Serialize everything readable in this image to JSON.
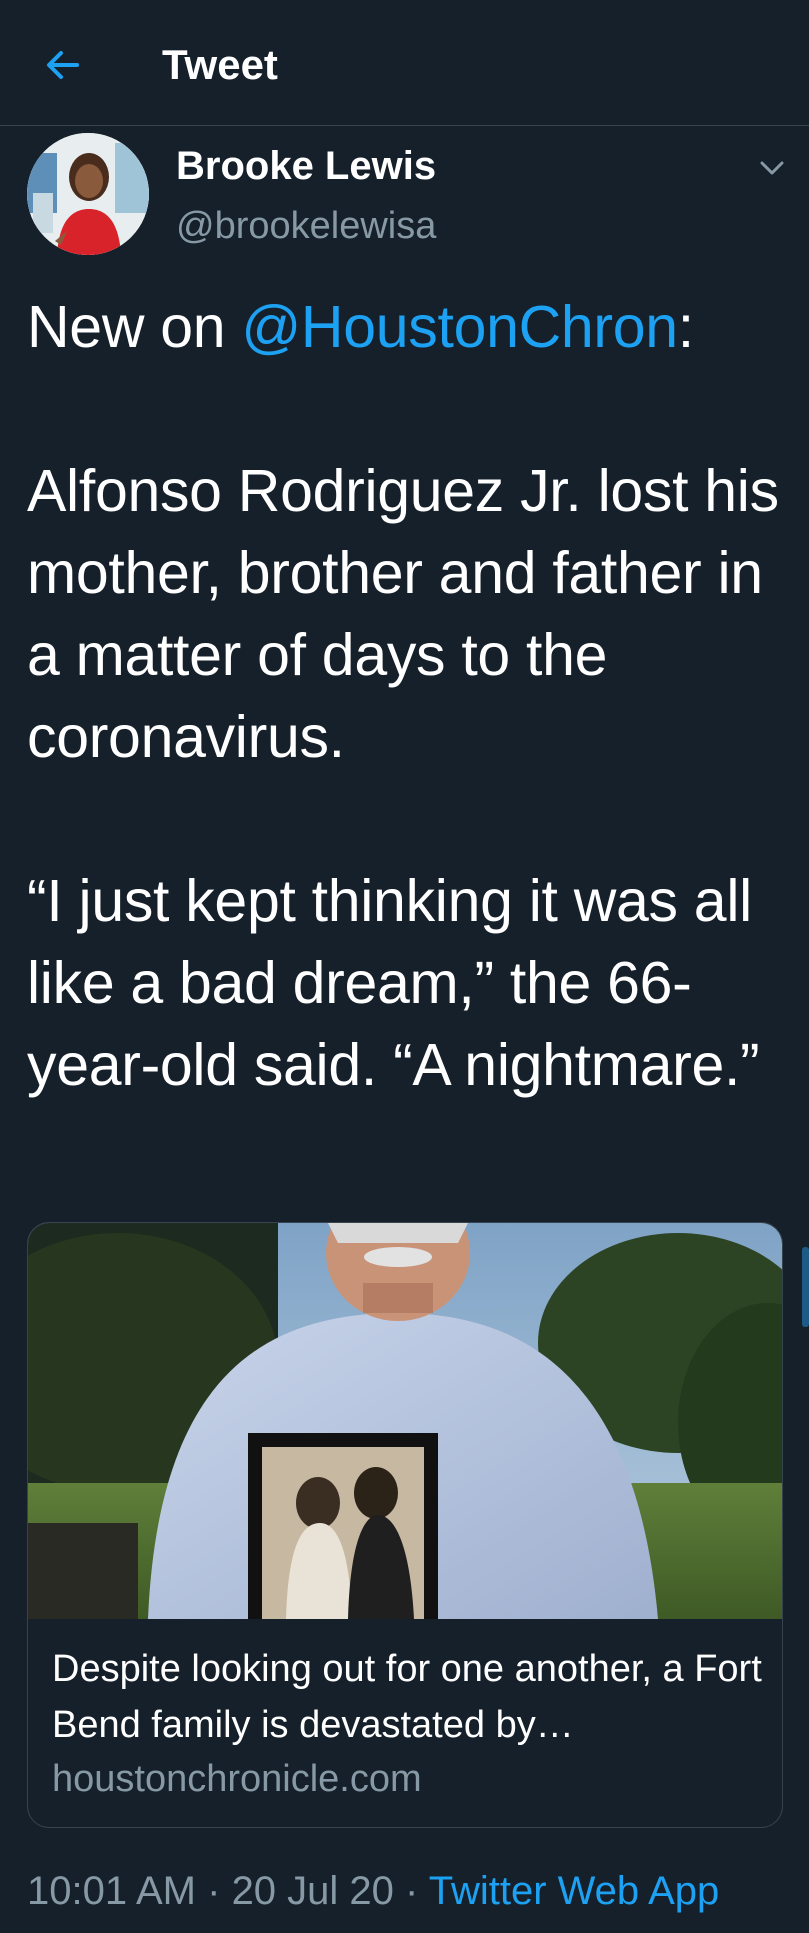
{
  "header": {
    "title": "Tweet",
    "back_icon": "arrow-left-icon"
  },
  "tweet": {
    "author": {
      "name": "Brooke Lewis",
      "handle": "@brookelewisa"
    },
    "text": {
      "prefix": "New on ",
      "mention": "@HoustonChron",
      "after_mention": ":",
      "body": "Alfonso Rodriguez Jr. lost his mother, brother and father in a matter of days to the coronavirus.\n\n“I just kept thinking it was all like a bad dream,” the 66-year-old said. “A nightmare.”"
    },
    "card": {
      "title": "Despite looking out for one another, a Fort Bend family is devastated by…",
      "domain": "houstonchronicle.com"
    },
    "meta": {
      "time": "10:01 AM",
      "separator": " · ",
      "date": "20 Jul 20",
      "source": "Twitter Web App"
    }
  },
  "colors": {
    "background": "#15202b",
    "accent": "#1da1f2",
    "secondary_text": "#8899a6",
    "border": "#38444d"
  }
}
